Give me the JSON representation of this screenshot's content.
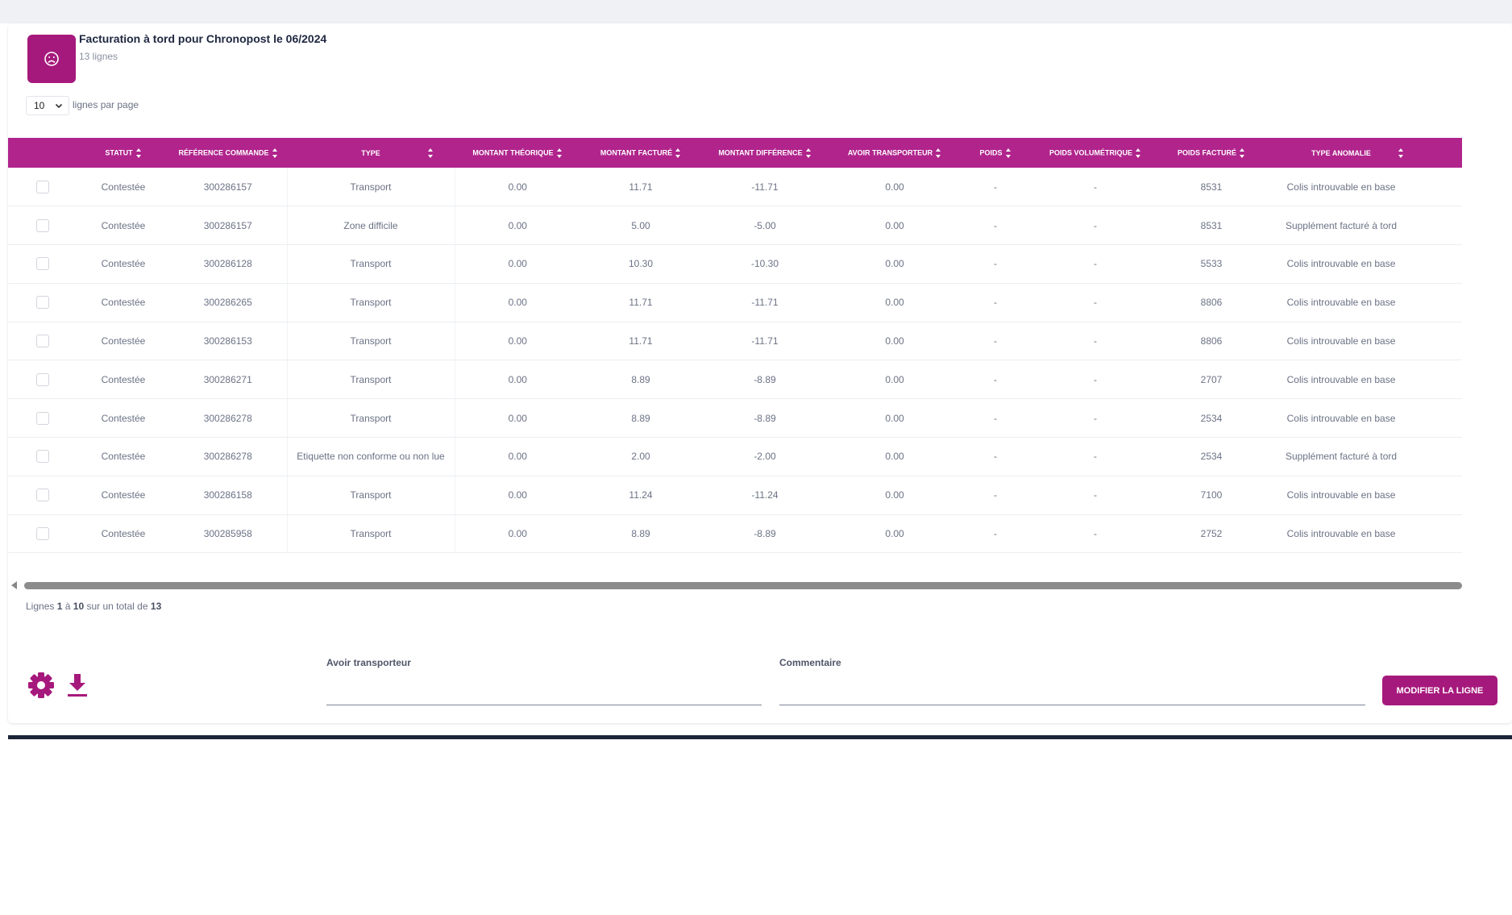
{
  "colors": {
    "accent": "#a6197c",
    "table_header": "#b0248c",
    "page_bg": "#f0f1f5"
  },
  "header": {
    "icon": "sad-face-icon",
    "title": "Facturation à tord pour Chronopost le 06/2024",
    "subtitle": "13 lignes"
  },
  "page_size": {
    "value": "10",
    "label": "lignes par page"
  },
  "table": {
    "columns": [
      "Statut",
      "Référence commande",
      "Type",
      "Montant théorique",
      "Montant facturé",
      "Montant différence",
      "Avoir transporteur",
      "Poids",
      "Poids volumétrique",
      "Poids facturé",
      "Type anomalie"
    ],
    "rows": [
      [
        "Contestée",
        "300286157",
        "Transport",
        "0.00",
        "11.71",
        "-11.71",
        "0.00",
        "-",
        "-",
        "8531",
        "Colis introuvable en base"
      ],
      [
        "Contestée",
        "300286157",
        "Zone difficile",
        "0.00",
        "5.00",
        "-5.00",
        "0.00",
        "-",
        "-",
        "8531",
        "Supplément facturé à tord"
      ],
      [
        "Contestée",
        "300286128",
        "Transport",
        "0.00",
        "10.30",
        "-10.30",
        "0.00",
        "-",
        "-",
        "5533",
        "Colis introuvable en base"
      ],
      [
        "Contestée",
        "300286265",
        "Transport",
        "0.00",
        "11.71",
        "-11.71",
        "0.00",
        "-",
        "-",
        "8806",
        "Colis introuvable en base"
      ],
      [
        "Contestée",
        "300286153",
        "Transport",
        "0.00",
        "11.71",
        "-11.71",
        "0.00",
        "-",
        "-",
        "8806",
        "Colis introuvable en base"
      ],
      [
        "Contestée",
        "300286271",
        "Transport",
        "0.00",
        "8.89",
        "-8.89",
        "0.00",
        "-",
        "-",
        "2707",
        "Colis introuvable en base"
      ],
      [
        "Contestée",
        "300286278",
        "Transport",
        "0.00",
        "8.89",
        "-8.89",
        "0.00",
        "-",
        "-",
        "2534",
        "Colis introuvable en base"
      ],
      [
        "Contestée",
        "300286278",
        "Etiquette non conforme ou non lue",
        "0.00",
        "2.00",
        "-2.00",
        "0.00",
        "-",
        "-",
        "2534",
        "Supplément facturé à tord"
      ],
      [
        "Contestée",
        "300286158",
        "Transport",
        "0.00",
        "11.24",
        "-11.24",
        "0.00",
        "-",
        "-",
        "7100",
        "Colis introuvable en base"
      ],
      [
        "Contestée",
        "300285958",
        "Transport",
        "0.00",
        "8.89",
        "-8.89",
        "0.00",
        "-",
        "-",
        "2752",
        "Colis introuvable en base"
      ]
    ]
  },
  "pagination": {
    "prefix": "Lignes",
    "from": "1",
    "sep": "à",
    "to": "10",
    "mid": "sur un total de",
    "total": "13"
  },
  "footer": {
    "settings_icon": "gear-icon",
    "download_icon": "download-icon",
    "avoir_label": "Avoir transporteur",
    "avoir_value": "",
    "comment_label": "Commentaire",
    "comment_value": "",
    "modify_label": "Modifier la ligne"
  }
}
